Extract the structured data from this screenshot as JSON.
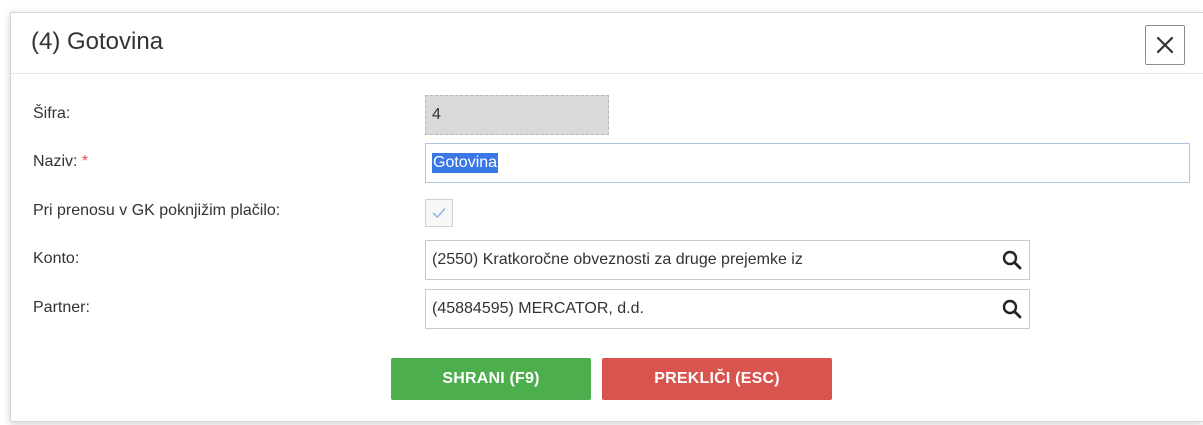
{
  "dialog": {
    "title": "(4) Gotovina",
    "close_symbol": "×"
  },
  "form": {
    "sifra_label": "Šifra:",
    "sifra_value": "4",
    "naziv_label": "Naziv:",
    "naziv_required": "*",
    "naziv_value": "Gotovina",
    "prenos_label": "Pri prenosu v GK poknjižim plačilo:",
    "prenos_checked": true,
    "konto_label": "Konto:",
    "konto_value": "(2550) Kratkoročne obveznosti za druge prejemke iz",
    "partner_label": "Partner:",
    "partner_value": "(45884595) MERCATOR, d.d."
  },
  "buttons": {
    "save_label": "SHRANI (F9)",
    "cancel_label": "PREKLIČI (ESC)"
  },
  "colors": {
    "save": "#4cae4c",
    "cancel": "#d9534f",
    "required": "#d9534f",
    "selection": "#3b78e7"
  },
  "icons": {
    "close": "close-icon",
    "search": "search-icon",
    "check": "check-icon"
  }
}
